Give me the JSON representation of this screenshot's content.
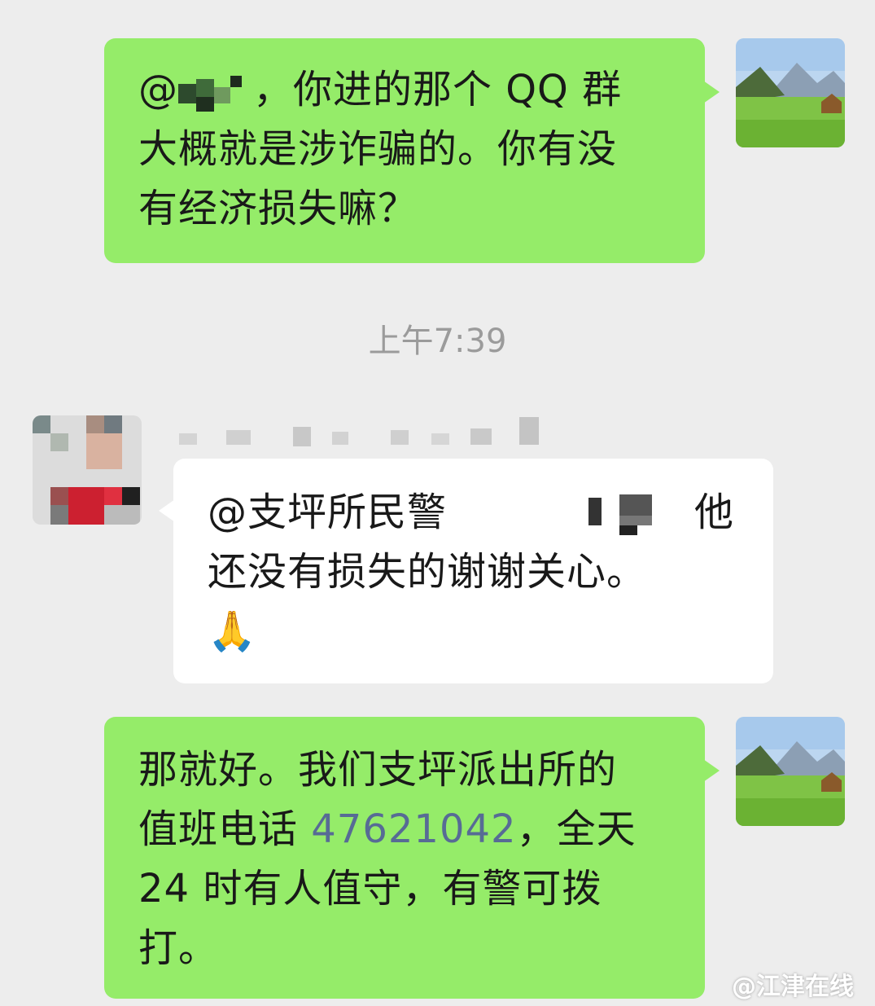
{
  "messages": [
    {
      "side": "outgoing",
      "mention": "@",
      "lines": [
        "，你进的那个 QQ 群",
        "大概就是涉诈骗的。你有没",
        "有经济损失嘛？"
      ]
    },
    {
      "side": "incoming",
      "lines": [
        "@支坪所民警",
        "他",
        "还没有损失的谢谢关心。"
      ],
      "emoji": "🙏"
    },
    {
      "side": "outgoing",
      "lines": [
        "那就好。我们支坪派出所的",
        "值班电话 ",
        "47621042",
        "，全天",
        "24 时有人值守，有警可拨",
        "打。"
      ]
    }
  ],
  "timestamp": "上午7:39",
  "watermark": "@江津在线",
  "colors": {
    "background": "#ededed",
    "outgoing_bubble": "#95ec69",
    "incoming_bubble": "#ffffff",
    "link": "#576b95",
    "timestamp": "#9b9b9b"
  }
}
